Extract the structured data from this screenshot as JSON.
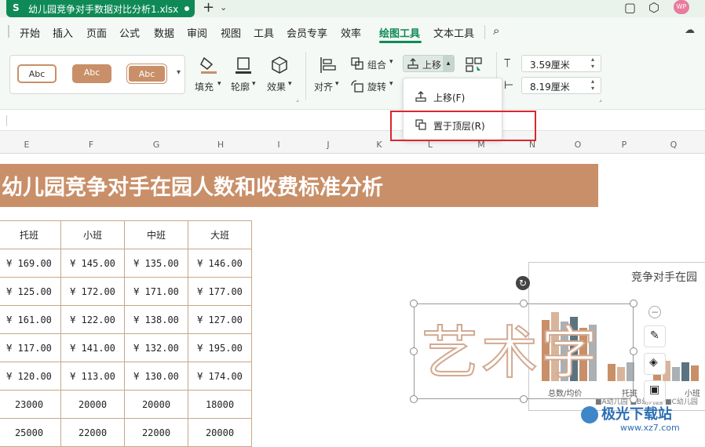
{
  "titlebar": {
    "filename": "幼儿园竞争对手数据对比分析1.xlsx",
    "app_badge": "S",
    "add_icon": "plus-icon",
    "avatar_label": "WP"
  },
  "menu": [
    "开始",
    "插入",
    "页面",
    "公式",
    "数据",
    "审阅",
    "视图",
    "工具",
    "会员专享",
    "效率",
    "绘图工具",
    "文本工具"
  ],
  "active_menu": "绘图工具",
  "ribbon": {
    "style_presets": [
      "Abc",
      "Abc",
      "Abc"
    ],
    "fill_label": "填充",
    "outline_label": "轮廓",
    "effect_label": "效果",
    "align_label": "对齐",
    "group_label": "组合",
    "rotate_label": "旋转",
    "move_up_label": "上移",
    "height_value": "3.59厘米",
    "width_value": "8.19厘米"
  },
  "dropdown": {
    "item1": "上移(F)",
    "item2": "置于顶层(R)"
  },
  "columns": [
    "E",
    "F",
    "G",
    "H",
    "I",
    "J",
    "K",
    "L",
    "M",
    "N",
    "O",
    "P",
    "Q"
  ],
  "sheet": {
    "banner_title": "幼儿园竞争对手在园人数和收费标准分析",
    "table_headers": [
      "托班",
      "小班",
      "中班",
      "大班"
    ],
    "table_rows": [
      [
        "¥ 169.00",
        "¥ 145.00",
        "¥ 135.00",
        "¥ 146.00"
      ],
      [
        "¥ 125.00",
        "¥ 172.00",
        "¥ 171.00",
        "¥ 177.00"
      ],
      [
        "¥ 161.00",
        "¥ 122.00",
        "¥ 138.00",
        "¥ 127.00"
      ],
      [
        "¥ 117.00",
        "¥ 141.00",
        "¥ 132.00",
        "¥ 195.00"
      ],
      [
        "¥ 120.00",
        "¥ 113.00",
        "¥ 130.00",
        "¥ 174.00"
      ],
      [
        "23000",
        "20000",
        "20000",
        "18000"
      ],
      [
        "25000",
        "22000",
        "22000",
        "20000"
      ]
    ]
  },
  "chart": {
    "title": "竞争对手在园",
    "xlabel_1": "总数/均价",
    "xlabel_2": "托班",
    "xlabel_3": "小班",
    "legend": "■A幼儿园 ■B幼儿园 ■C幼儿园"
  },
  "wordart": {
    "text": "艺术字"
  },
  "watermark": {
    "text": "极光下载站",
    "url": "www.xz7.com"
  }
}
